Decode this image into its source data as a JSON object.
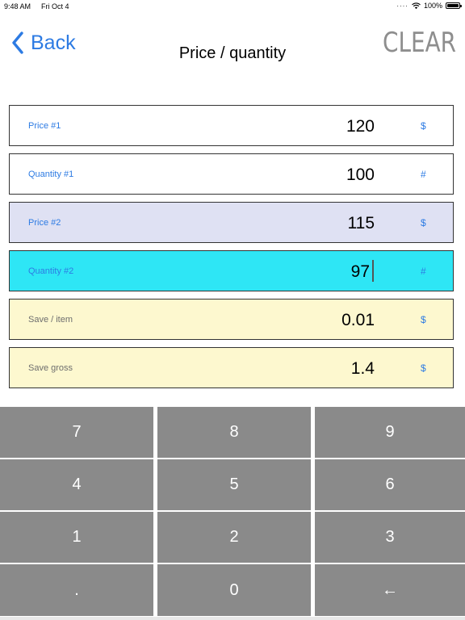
{
  "status_bar": {
    "time": "9:48 AM",
    "date": "Fri Oct 4",
    "battery": "100%"
  },
  "nav": {
    "back_label": "Back",
    "title": "Price / quantity",
    "clear_label": "CLEAR"
  },
  "rows": [
    {
      "label": "Price #1",
      "value": "120",
      "unit": "$"
    },
    {
      "label": "Quantity #1",
      "value": "100",
      "unit": "#"
    },
    {
      "label": "Price #2",
      "value": "115",
      "unit": "$"
    },
    {
      "label": "Quantity #2",
      "value": "97",
      "unit": "#"
    },
    {
      "label": "Save / item",
      "value": "0.01",
      "unit": "$"
    },
    {
      "label": "Save gross",
      "value": "1.4",
      "unit": "$"
    }
  ],
  "colors": {
    "accent_blue": "#2d7be3",
    "price2_bg": "#dfe1f3",
    "quantity2_bg": "#2ee6f5",
    "result_bg": "#fdf8cf",
    "key_bg": "#8a8a8a"
  },
  "keypad": {
    "keys": [
      "7",
      "8",
      "9",
      "4",
      "5",
      "6",
      "1",
      "2",
      "3",
      ".",
      "0",
      "←"
    ]
  }
}
